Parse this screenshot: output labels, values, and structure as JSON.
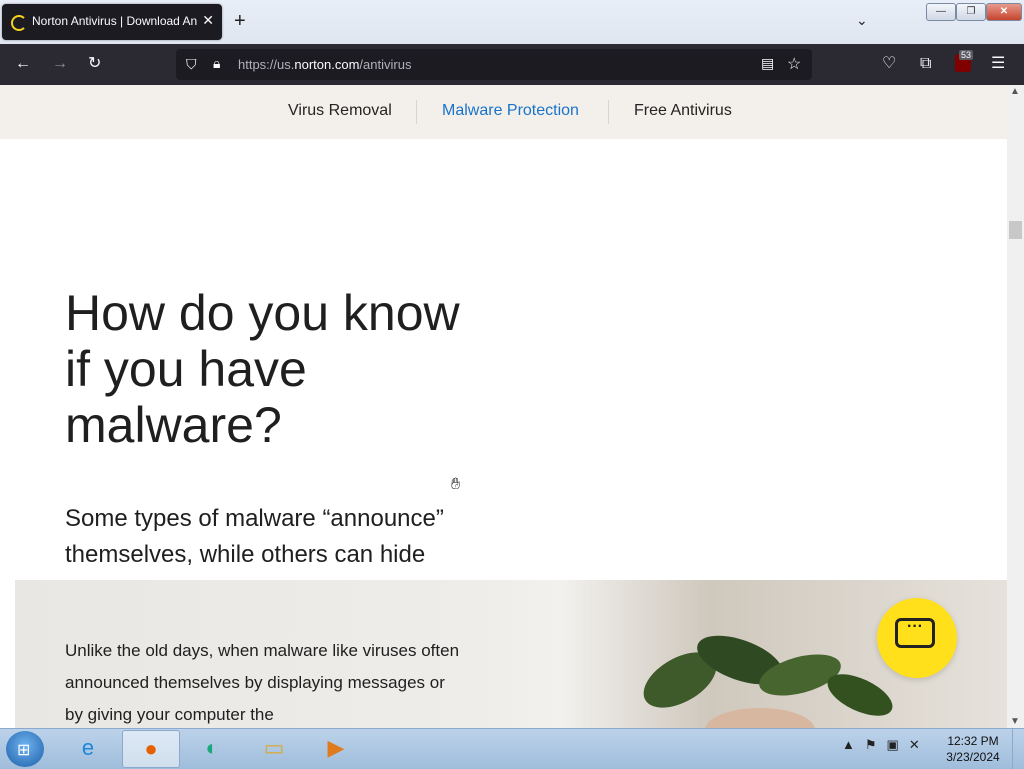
{
  "browser": {
    "tab_title": "Norton Antivirus | Download Antivirus",
    "tab_close": "✕",
    "new_tab": "+",
    "tab_list": "⌄",
    "window_controls": {
      "minimize": "—",
      "maximize": "❐",
      "close": "✕"
    }
  },
  "navbar": {
    "back": "←",
    "forward": "→",
    "reload": "↻",
    "url_scheme": "https://us.",
    "url_host": "norton.com",
    "url_path": "/antivirus",
    "ublock_count": "53",
    "icons": [
      "shield-icon",
      "lock-icon",
      "reader-view-icon",
      "bookmark-star-icon",
      "pocket-icon",
      "extensions-icon",
      "ublock-icon",
      "menu-icon"
    ]
  },
  "page": {
    "subnav": [
      "Virus Removal",
      "Malware Protection",
      "Free Antivirus"
    ],
    "subnav_active": "Malware Protection",
    "heading": "How do you know if you have malware?",
    "subheading": "Some types of malware “announce” themselves, while others can hide on your device",
    "body": "Unlike the old days, when malware like viruses often announced themselves by displaying messages or by giving your computer the",
    "chat_icon": "chat-icon",
    "accent_color": "#1a73c8",
    "chat_color": "#ffe01b"
  },
  "taskbar": {
    "apps": [
      "internet-explorer-icon",
      "firefox-icon",
      "edge-icon",
      "file-explorer-icon",
      "media-player-icon"
    ],
    "time": "12:32 PM",
    "date": "3/23/2024"
  }
}
